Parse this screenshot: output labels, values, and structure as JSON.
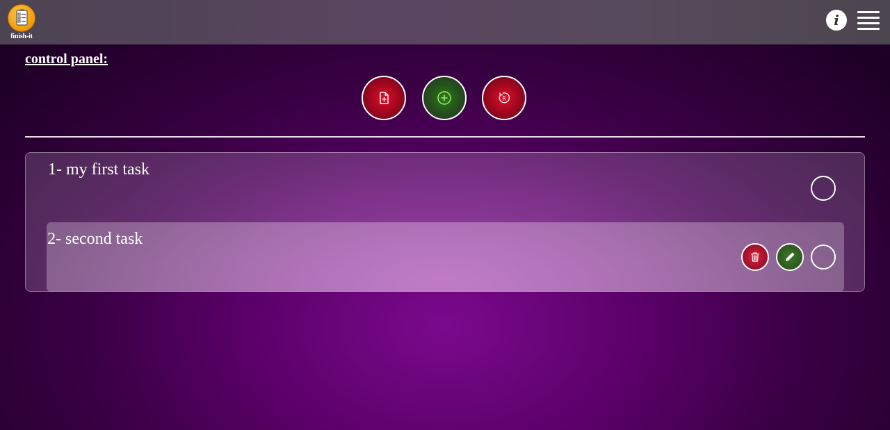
{
  "header": {
    "logo_caption": "finish-it",
    "info_label": "i"
  },
  "control_panel": {
    "title": "control panel:",
    "buttons": [
      {
        "name": "new-file",
        "icon": "file-plus-icon",
        "color": "#e0102a"
      },
      {
        "name": "add-task",
        "icon": "plus-circle-icon",
        "color": "#2f7a18"
      },
      {
        "name": "reset",
        "icon": "reset-icon",
        "color": "#e0102a"
      }
    ]
  },
  "tasks": [
    {
      "label": "1- my first task",
      "done": false
    },
    {
      "label": "2- second task",
      "done": false,
      "actions": [
        "delete",
        "edit"
      ]
    }
  ],
  "colors": {
    "accent_red": "#e0102a",
    "accent_green": "#2f7a18",
    "logo_orange": "#f3a10f"
  }
}
